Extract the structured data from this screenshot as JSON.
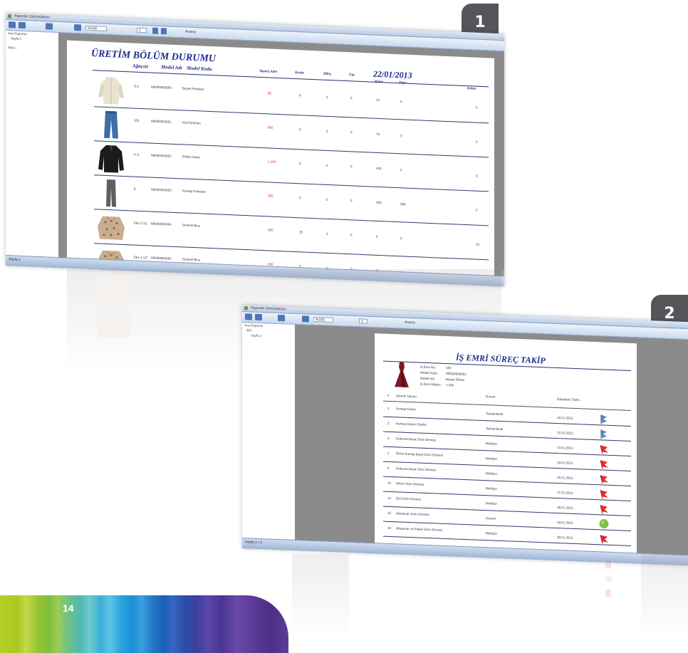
{
  "badges": {
    "one": "1",
    "two": "2"
  },
  "page_number": "14",
  "screen1": {
    "window_title": "Raporlar Görüntüleyici",
    "toolbar_field": "1",
    "toolbar_zoom": "%100",
    "toolbar_search": "Arama",
    "tree": [
      "Ana Raporlar",
      "Sayfa 1",
      "Ekler..."
    ],
    "status": "Sayfa 1",
    "report_title": "ÜRETİM BÖLÜM DURUMU",
    "report_date": "22/01/2013",
    "columns": [
      "Ağaçsiz",
      "Model Adı",
      "Model Kodu",
      "Sipariş Adet",
      "Kesim",
      "Dikiş",
      "Ütü",
      "Paket",
      "Depo",
      "Kalan"
    ],
    "rows": [
      {
        "garment": "cream-trench-coat",
        "code": "S-1",
        "model_no": "M0000000000",
        "model_name": "Bayan Pardesü",
        "qty": "85",
        "v1": "0",
        "v2": "0",
        "v3": "0",
        "v4": "13",
        "v5": "0",
        "end": "0"
      },
      {
        "garment": "blue-jeans",
        "code": "100",
        "model_no": "M0000000001",
        "model_name": "Kot Pantolon",
        "qty": "800",
        "v1": "0",
        "v2": "0",
        "v3": "0",
        "v4": "76",
        "v5": "0",
        "end": "0"
      },
      {
        "garment": "black-jacket",
        "code": "P-3",
        "model_no": "M0000000002",
        "model_name": "Erkek Ceket",
        "qty": "1.200",
        "v1": "0",
        "v2": "0",
        "v3": "0",
        "v4": "430",
        "v5": "0",
        "end": "0"
      },
      {
        "garment": "grey-trousers",
        "code": "8",
        "model_no": "M0000000003",
        "model_name": "Kumaş Pantolon",
        "qty": "350",
        "v1": "0",
        "v2": "0",
        "v3": "0",
        "v4": "300",
        "v5": "300",
        "end": "0"
      },
      {
        "garment": "patterned-blouse",
        "code": "Eko 1.1/1",
        "model_no": "M0000000004",
        "model_name": "Desenli Bluz",
        "qty": "500",
        "v1": "15",
        "v2": "0",
        "v3": "0",
        "v4": "0",
        "v5": "0",
        "end": "15"
      },
      {
        "garment": "patterned-blouse",
        "code": "Eko 1.1/2",
        "model_no": "M0000000005",
        "model_name": "Desenli Bluz",
        "qty": "600",
        "v1": "0",
        "v2": "0",
        "v3": "0",
        "v4": "0",
        "v5": "0",
        "end": "0"
      }
    ]
  },
  "screen2": {
    "window_title": "Raporlar Görüntüleyici",
    "toolbar_field": "1",
    "toolbar_zoom": "%100",
    "toolbar_search": "Arama",
    "tree": [
      "Ana Raporlar",
      "001",
      "Sayfa 1"
    ],
    "status": "Sayfa 1 / 1",
    "report_title": "İŞ EMRİ SÜREÇ TAKİP",
    "info_labels": [
      "İş Emri No",
      "Model Kodu",
      "Model Adı",
      "İş Emri Miktarı"
    ],
    "info_values": [
      "100",
      "M0000000001",
      "Bayan Elbise",
      "1.250"
    ],
    "columns": [
      "#",
      "İşlemin Tanımı",
      "Durum",
      "Gönderim Tarihi"
    ],
    "rows": [
      {
        "no": "1",
        "name": "Kumaş Kesim",
        "status": "Tamamlandı",
        "date": "10.01.2013",
        "icon": "blue-flag-icon"
      },
      {
        "no": "2",
        "name": "Kumaş Kesimi Teslim",
        "status": "Tamamlandı",
        "date": "12.01.2013",
        "icon": "blue-flag-icon"
      },
      {
        "no": "3",
        "name": "Dokuma Boya Ürün Girmesi",
        "status": "Bekliyor",
        "date": "14.01.2013",
        "icon": "red-flag-icon"
      },
      {
        "no": "4",
        "name": "Örme Kumaş Boya Ürün Girmesi",
        "status": "Bekliyor",
        "date": "15.01.2013",
        "icon": "red-flag-icon"
      },
      {
        "no": "5",
        "name": "Dokuma Boya Ürün Girmesi",
        "status": "Bekliyor",
        "date": "16.01.2013",
        "icon": "red-flag-icon"
      },
      {
        "no": "13",
        "name": "Dikim Ürün Girmesi",
        "status": "Bekliyor",
        "date": "17.01.2013",
        "icon": "red-flag-icon"
      },
      {
        "no": "14",
        "name": "Ütü Ürün Girmesi",
        "status": "Bekliyor",
        "date": "18.01.2013",
        "icon": "red-flag-icon"
      },
      {
        "no": "15",
        "name": "Aksesuar Ürün Girmesi",
        "status": "Devam",
        "date": "19.01.2013",
        "icon": "green-circle-icon"
      },
      {
        "no": "16",
        "name": "Aksesuar ve Paket Ürün Girmesi",
        "status": "Bekliyor",
        "date": "20.01.2013",
        "icon": "red-flag-icon"
      }
    ]
  },
  "colors": {
    "badge": "#55565a",
    "report_title": "#1f2a8c",
    "qty_red": "#d02020"
  }
}
